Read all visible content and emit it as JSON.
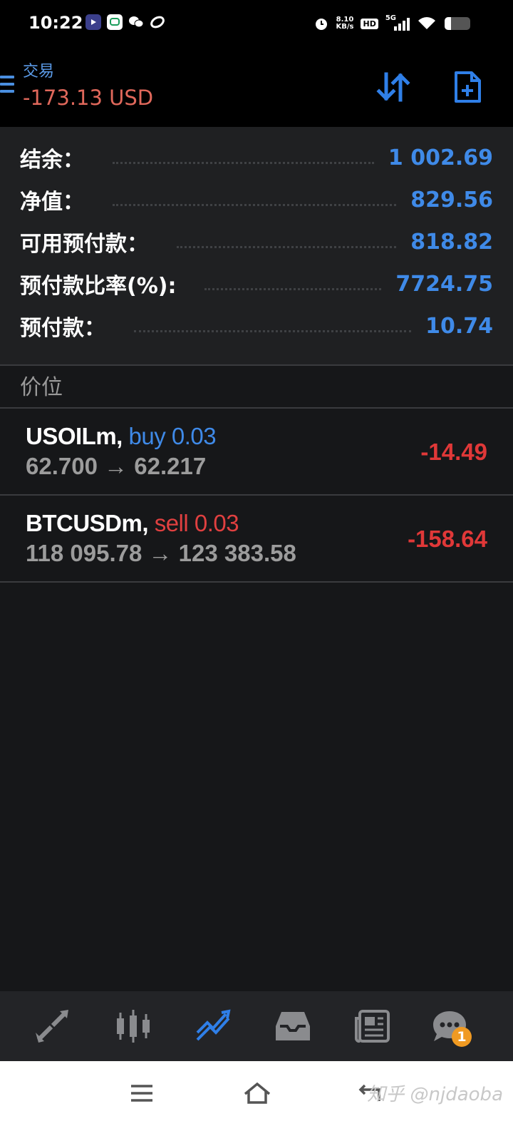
{
  "status_bar": {
    "time": "10:22",
    "net_speed_value": "8.10",
    "net_speed_unit": "KB/s",
    "hd": "HD",
    "network": "5G"
  },
  "header": {
    "title": "交易",
    "subtitle": "-173.13 USD",
    "accent_color": "#3f8ae8",
    "loss_color": "#e0685b"
  },
  "account": {
    "rows": [
      {
        "label": "结余：",
        "value": "1 002.69"
      },
      {
        "label": "净值：",
        "value": "829.56"
      },
      {
        "label": "可用预付款：",
        "value": "818.82"
      },
      {
        "label": "预付款比率(%):",
        "value": "7724.75"
      },
      {
        "label": "预付款：",
        "value": "10.74"
      }
    ]
  },
  "positions_section": {
    "label": "价位",
    "items": [
      {
        "symbol": "USOILm,",
        "side": "buy 0.03",
        "prices": "62.700 → 62.217",
        "profit": "-14.49"
      },
      {
        "symbol": "BTCUSDm,",
        "side": "sell 0.03",
        "prices": "118 095.78 → 123 383.58",
        "profit": "-158.64"
      }
    ]
  },
  "bottom_nav": {
    "active": "trade",
    "chat_badge": "1"
  },
  "watermark": "知乎 @njdaoba"
}
